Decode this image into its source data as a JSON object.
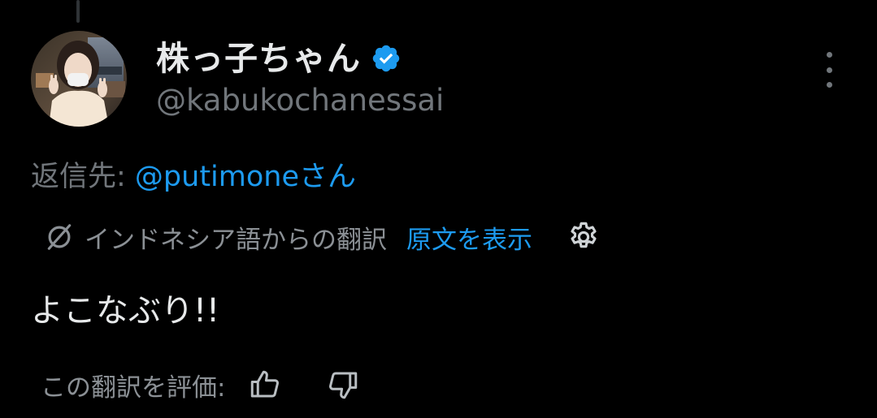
{
  "author": {
    "display_name": "株っ子ちゃん",
    "handle": "@kabukochanessai",
    "verified": true
  },
  "reply": {
    "prefix": "返信先: ",
    "target": "@putimoneさん"
  },
  "translation": {
    "label": "インドネシア語からの翻訳",
    "show_original": "原文を表示"
  },
  "post": {
    "text": "よこなぶり!!"
  },
  "rating": {
    "label": "この翻訳を評価:"
  },
  "colors": {
    "accent": "#1d9bf0",
    "background": "#000000",
    "secondary_text": "#71767b"
  },
  "icons": {
    "verified": "verified-badge-icon",
    "more": "more-vertical-icon",
    "translate": "translate-slash-icon",
    "settings": "gear-icon",
    "like": "thumbs-up-icon",
    "dislike": "thumbs-down-icon"
  }
}
